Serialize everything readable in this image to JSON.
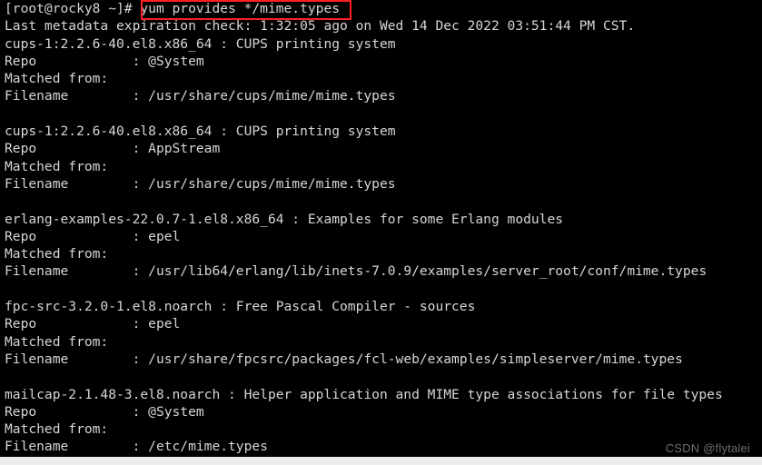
{
  "terminal": {
    "background_color": "#000000",
    "text_color": "#d6d6d6",
    "highlight_color": "#fd1f1f",
    "prompt": "[root@rocky8 ~]# ",
    "command": "yum provides */mime.types",
    "status_line": "Last metadata expiration check: 1:32:05 ago on Wed 14 Dec 2022 03:51:44 PM CST.",
    "label_repo": "Repo            : ",
    "label_matched": "Matched from:",
    "label_filename": "Filename        : ",
    "packages": [
      {
        "header": "cups-1:2.2.6-40.el8.x86_64 : CUPS printing system",
        "repo": "@System",
        "matched_from": "Matched from:",
        "filename": "/usr/share/cups/mime/mime.types"
      },
      {
        "header": "cups-1:2.2.6-40.el8.x86_64 : CUPS printing system",
        "repo": "AppStream",
        "matched_from": "Matched from:",
        "filename": "/usr/share/cups/mime/mime.types"
      },
      {
        "header": "erlang-examples-22.0.7-1.el8.x86_64 : Examples for some Erlang modules",
        "repo": "epel",
        "matched_from": "Matched from:",
        "filename": "/usr/lib64/erlang/lib/inets-7.0.9/examples/server_root/conf/mime.types"
      },
      {
        "header": "fpc-src-3.2.0-1.el8.noarch : Free Pascal Compiler - sources",
        "repo": "epel",
        "matched_from": "Matched from:",
        "filename": "/usr/share/fpcsrc/packages/fcl-web/examples/simpleserver/mime.types"
      },
      {
        "header": "mailcap-2.1.48-3.el8.noarch : Helper application and MIME type associations for file types",
        "repo": "@System",
        "matched_from": "Matched from:",
        "filename": "/etc/mime.types"
      }
    ]
  },
  "watermark": {
    "text": "CSDN @flytalei"
  }
}
